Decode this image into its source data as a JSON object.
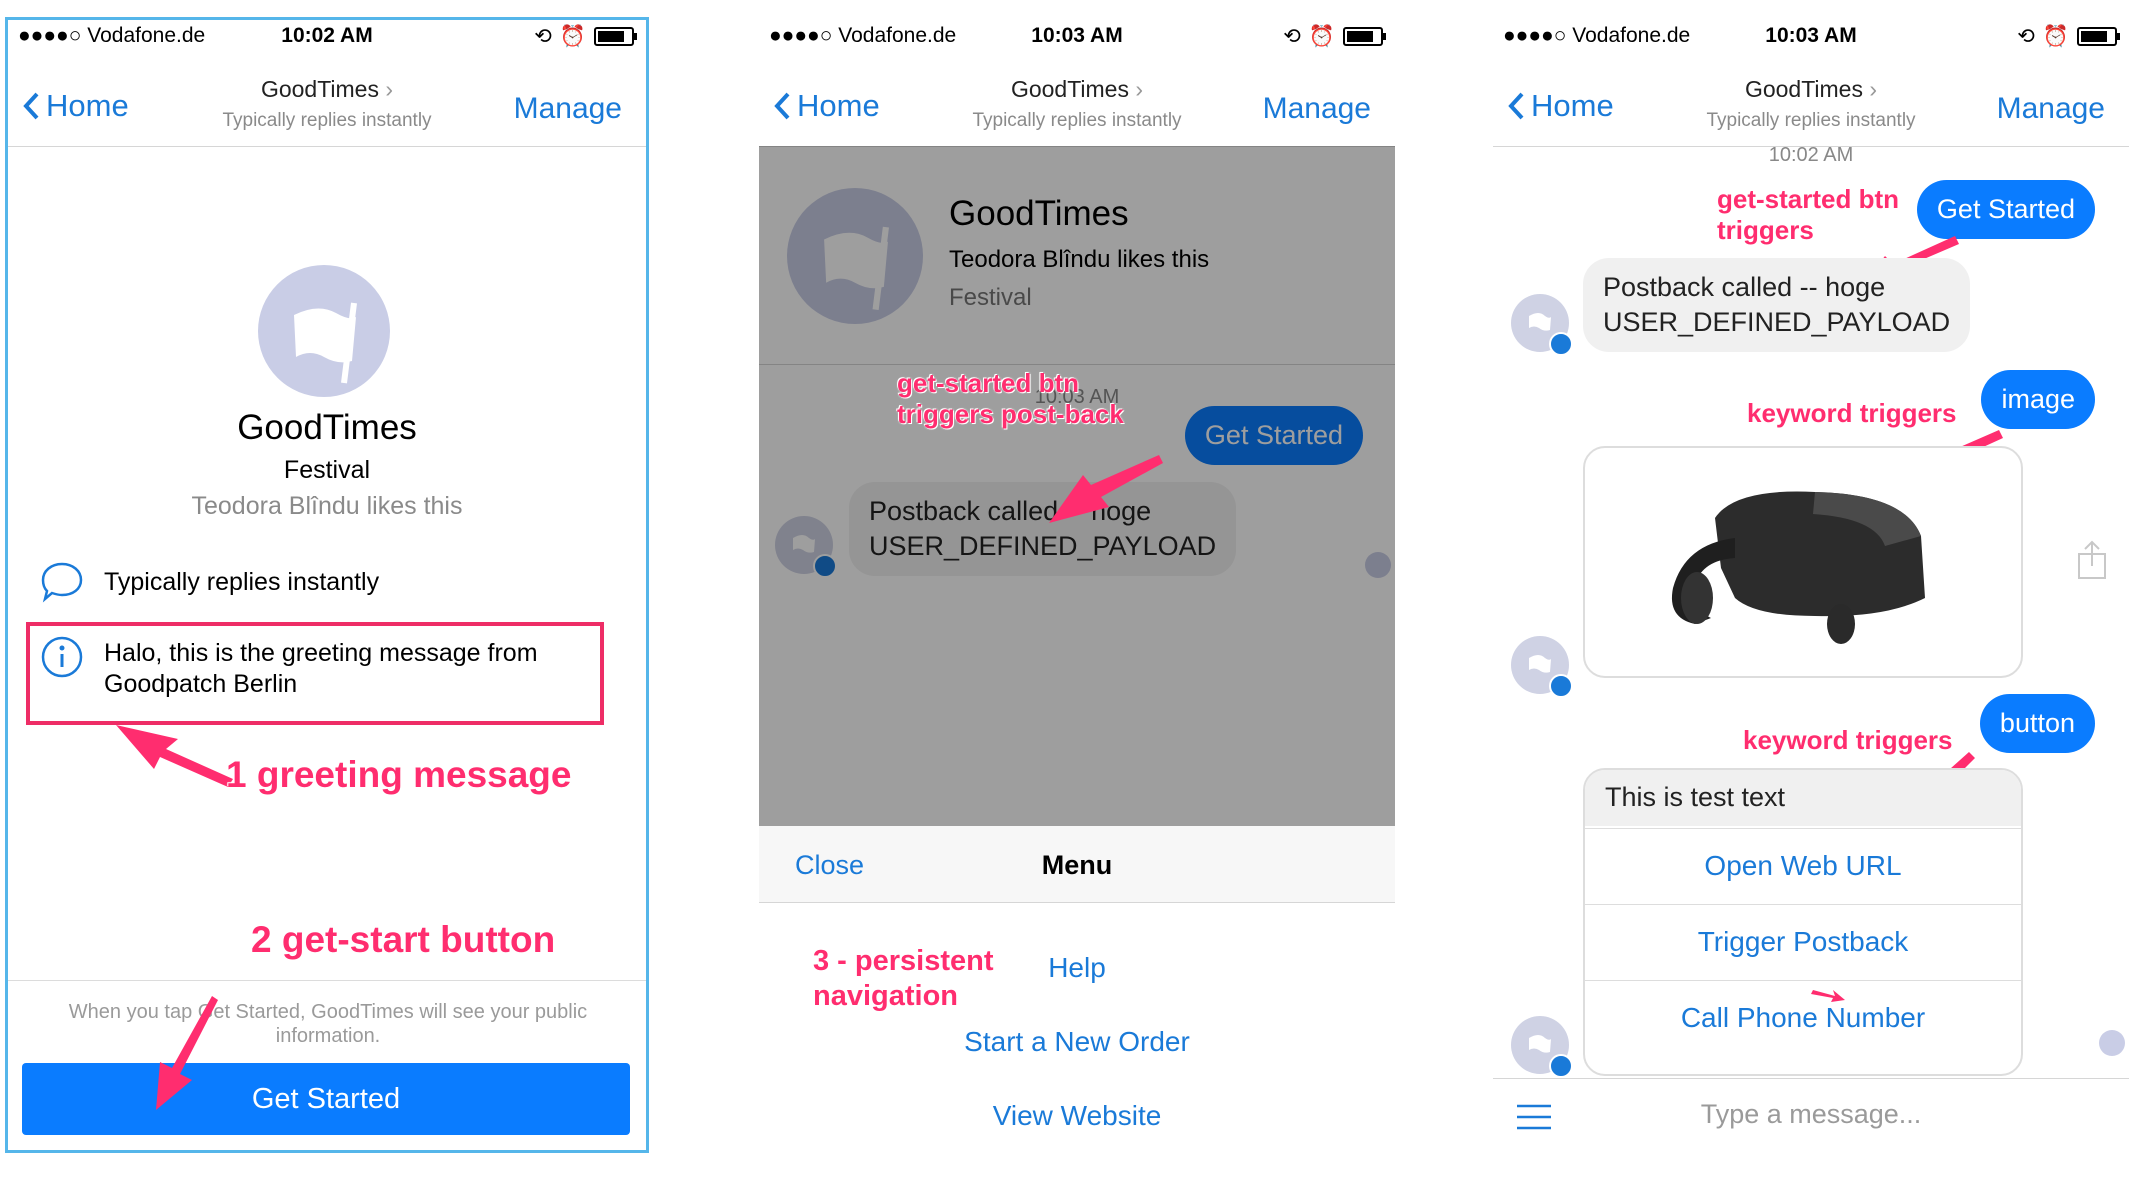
{
  "status": {
    "carrier": "●●●●○ Vodafone.de",
    "time1": "10:02 AM",
    "time2": "10:03 AM",
    "time3": "10:03 AM"
  },
  "nav": {
    "back": "Home",
    "title": "GoodTimes",
    "subtitle": "Typically replies instantly",
    "manage": "Manage"
  },
  "phone1": {
    "page_name": "GoodTimes",
    "page_category": "Festival",
    "likes": "Teodora Blîndu likes this",
    "replies": "Typically replies instantly",
    "greeting": "Halo, this is the greeting message from Goodpatch Berlin",
    "notice": "When you tap Get Started, GoodTimes will see your public information.",
    "get_started": "Get Started",
    "ann_greeting": "1 greeting message",
    "ann_button": "2 get-start button"
  },
  "phone2": {
    "page_name": "GoodTimes",
    "likes": "Teodora Blîndu likes this",
    "page_category": "Festival",
    "timestamp": "10:03 AM",
    "get_started": "Get Started",
    "postback": "Postback called -- hoge\nUSER_DEFINED_PAYLOAD",
    "ann_postback": "get-started btn\ntriggers post-back",
    "menu_close": "Close",
    "menu_title": "Menu",
    "menu_items": [
      "Help",
      "Start a New Order",
      "View Website"
    ],
    "ann_menu": "3 - persistent\nnavigation"
  },
  "phone3": {
    "timestamp": "10:02 AM",
    "get_started": "Get Started",
    "ann_get_started": "get-started btn\ntriggers",
    "postback": "Postback called -- hoge\nUSER_DEFINED_PAYLOAD",
    "image_msg": "image",
    "ann_image": "keyword triggers",
    "button_msg": "button",
    "ann_button": "keyword triggers",
    "card_text": "This is test text",
    "card_buttons": [
      "Open Web URL",
      "Trigger Postback",
      "Call Phone Number"
    ],
    "composer_placeholder": "Type a message..."
  },
  "colors": {
    "accent": "#0a7cff",
    "link": "#1a7ad8",
    "annotation": "#ff2d6f"
  }
}
